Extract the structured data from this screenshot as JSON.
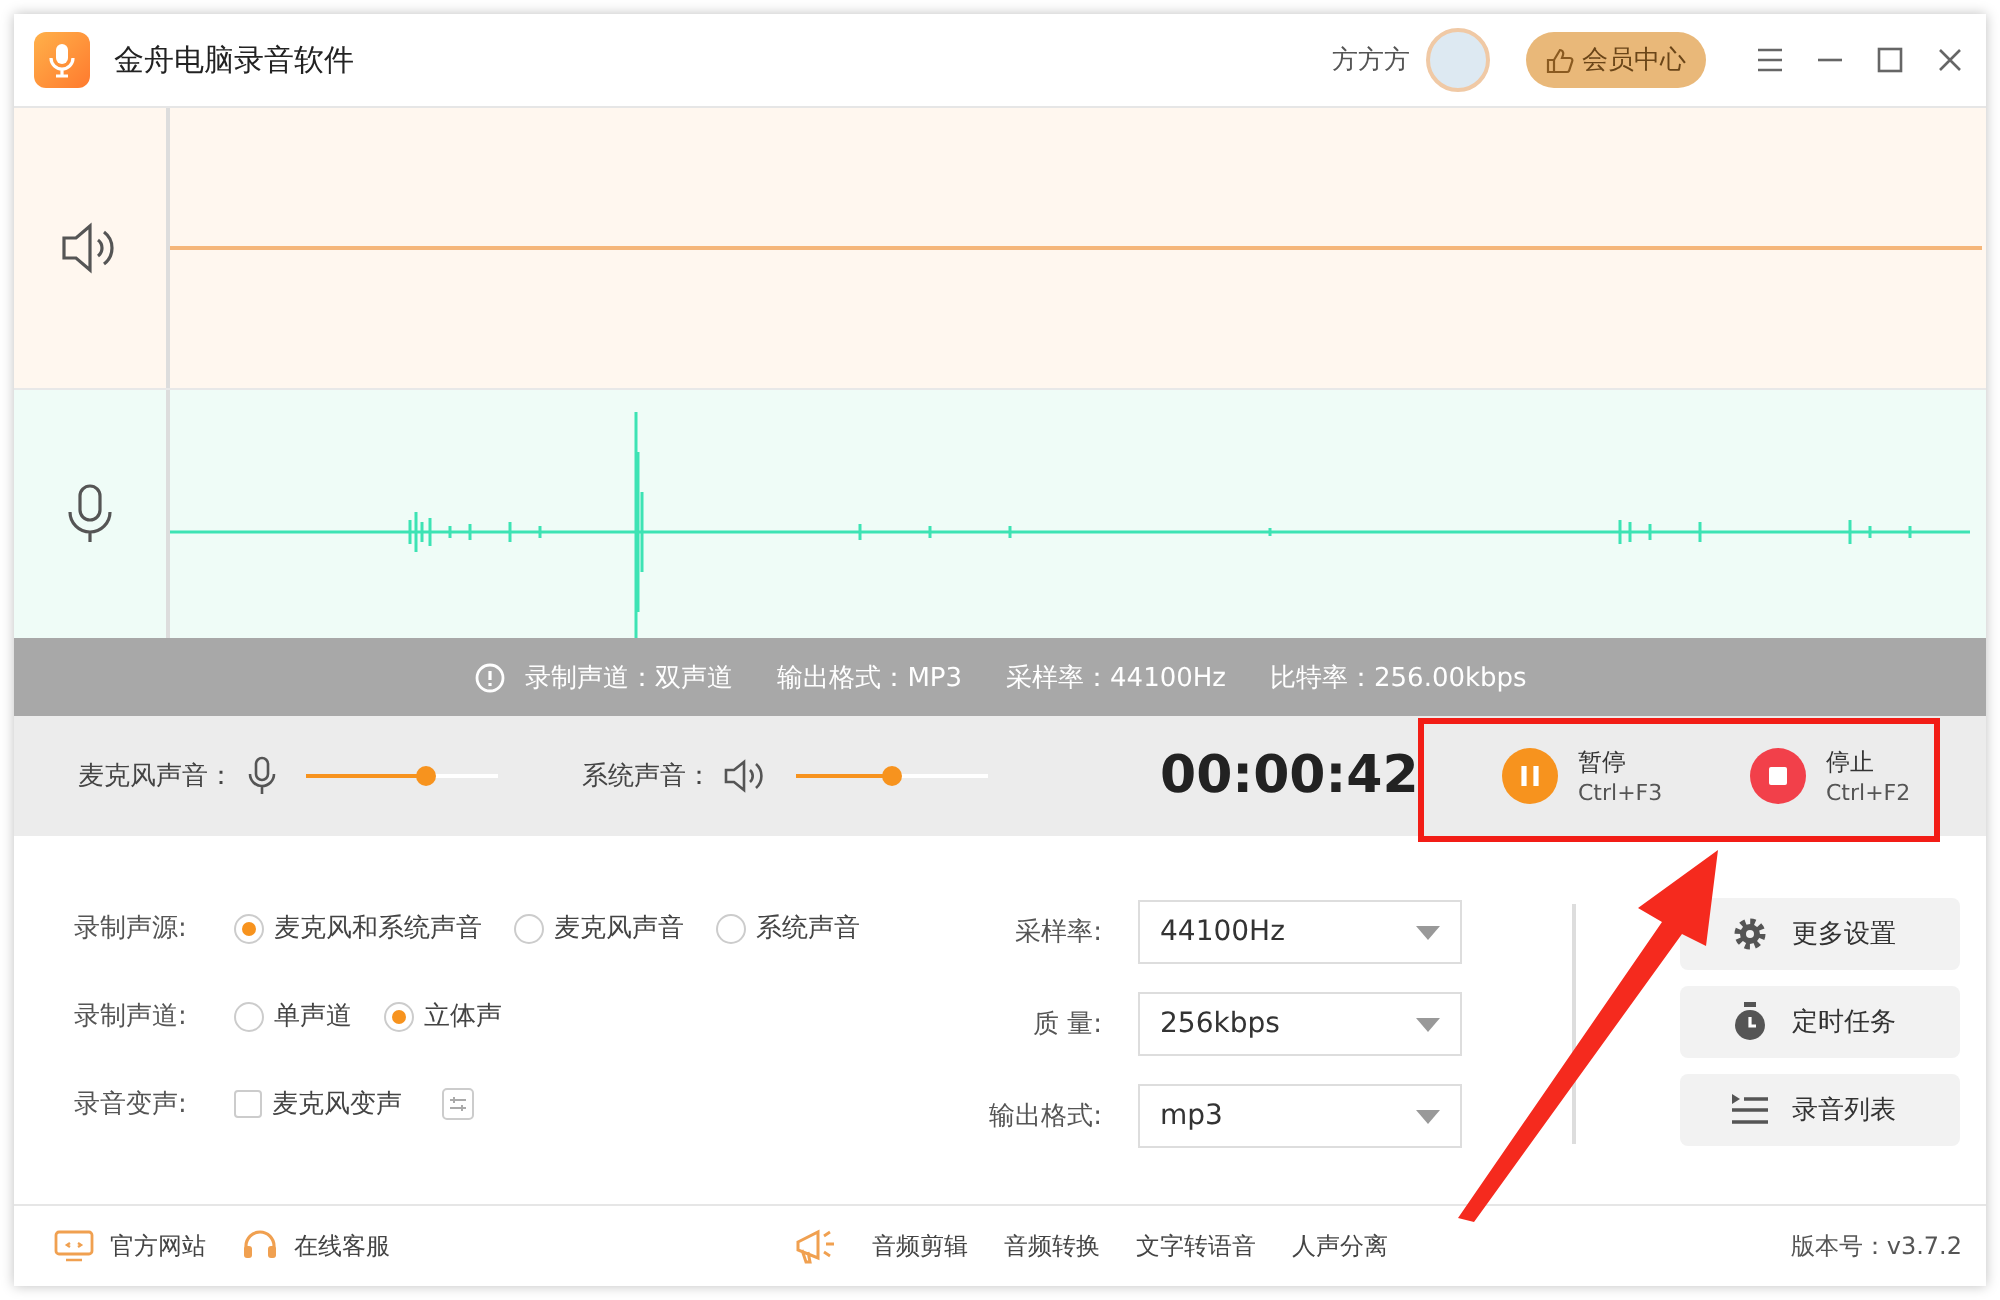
{
  "window": {
    "title": "金舟电脑录音软件",
    "user_name": "方方方",
    "vip_button": "会员中心"
  },
  "info_bar": [
    {
      "label": "录制声道：",
      "value": "双声道"
    },
    {
      "label": "输出格式：",
      "value": "MP3"
    },
    {
      "label": "采样率：",
      "value": "44100Hz"
    },
    {
      "label": "比特率：",
      "value": "256.00kbps"
    }
  ],
  "volume": [
    {
      "label": "麦克风声音：",
      "kind": "mic",
      "level": 0.62
    },
    {
      "label": "系统声音：",
      "kind": "speaker",
      "level": 0.5
    }
  ],
  "timer": "00:00:42",
  "record_buttons": [
    {
      "kind": "pause",
      "label": "暂停",
      "shortcut": "Ctrl+F3"
    },
    {
      "kind": "stop",
      "label": "停止",
      "shortcut": "Ctrl+F2"
    }
  ],
  "options": [
    {
      "label": "录制声源:",
      "kind": "radio",
      "items": [
        {
          "label": "麦克风和系统声音",
          "selected": true
        },
        {
          "label": "麦克风声音",
          "selected": false
        },
        {
          "label": "系统声音",
          "selected": false
        }
      ]
    },
    {
      "label": "录制声道:",
      "kind": "radio",
      "items": [
        {
          "label": "单声道",
          "selected": false
        },
        {
          "label": "立体声",
          "selected": true
        }
      ]
    },
    {
      "label": "录音变声:",
      "kind": "checkbox",
      "items": [
        {
          "label": "麦克风变声",
          "checked": false
        }
      ]
    }
  ],
  "dropdowns": [
    {
      "label": "采样率:",
      "value": "44100Hz"
    },
    {
      "label": "质 量:",
      "value": "256kbps"
    },
    {
      "label": "输出格式:",
      "value": "mp3"
    }
  ],
  "side_buttons": [
    {
      "kind": "gear",
      "label": "更多设置"
    },
    {
      "kind": "timer",
      "label": "定时任务"
    },
    {
      "kind": "list",
      "label": "录音列表"
    }
  ],
  "footer": {
    "left": [
      {
        "kind": "monitor",
        "label": "官方网站"
      },
      {
        "kind": "headset",
        "label": "在线客服"
      }
    ],
    "tools": [
      "音频剪辑",
      "音频转换",
      "文字转语音",
      "人声分离"
    ],
    "version": "版本号：v3.7.2"
  }
}
